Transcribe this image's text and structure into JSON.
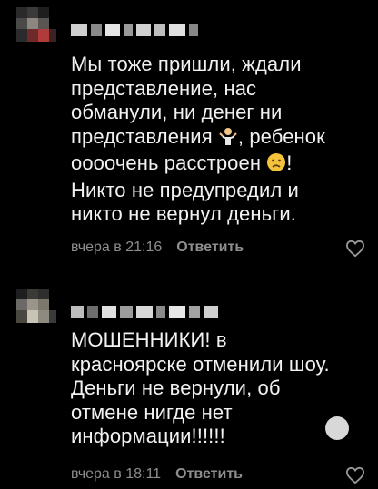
{
  "comments": [
    {
      "author": "",
      "text_before_emoji1": "Мы тоже пришли, ждали представление, нас обманули, ни денег ни представления ",
      "emoji1": "person-shrugging-icon",
      "text_mid": ", ребенок оооочень расстроен ",
      "emoji2": "worried-face-icon",
      "text_after": "! Никто не предупредил и никто не вернул деньги.",
      "time": "вчера в 21:16",
      "reply_label": "Ответить"
    },
    {
      "author": "",
      "text": "МОШЕННИКИ! в красноярске отменили шоу. Деньги не вернули, об отмене нигде нет информации!!!!!!",
      "time": "вчера в 18:11",
      "reply_label": "Ответить"
    }
  ],
  "colors": {
    "background": "#000000",
    "text": "#f2f2f2",
    "meta": "#8e8e8e"
  }
}
